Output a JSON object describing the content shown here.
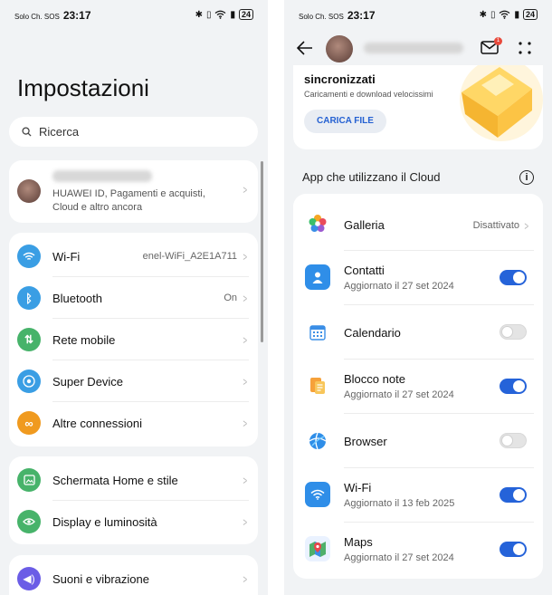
{
  "colors": {
    "accent": "#2563d9",
    "background": "#f1f3f5",
    "card": "#ffffff",
    "wifi": "#3a9ee4",
    "bluetooth": "#3a9ee4",
    "mobile": "#47b36a",
    "super_device": "#3a9ee4",
    "connections": "#f09a1f",
    "home": "#47b36a",
    "display": "#47b36a",
    "sound": "#6b5de6"
  },
  "left": {
    "status": {
      "carrier": "Solo Ch. SOS",
      "time": "23:17",
      "battery": "24"
    },
    "title": "Impostazioni",
    "search": {
      "placeholder": "Ricerca",
      "icon": "search-icon"
    },
    "account": {
      "subtitle": "HUAWEI ID, Pagamenti e acquisti, Cloud e altro ancora"
    },
    "group1": [
      {
        "label": "Wi-Fi",
        "value": "enel-WiFi_A2E1A711",
        "icon": "wifi-icon"
      },
      {
        "label": "Bluetooth",
        "value": "On",
        "icon": "bluetooth-icon"
      },
      {
        "label": "Rete mobile",
        "value": "",
        "icon": "mobile-network-icon"
      },
      {
        "label": "Super Device",
        "value": "",
        "icon": "super-device-icon"
      },
      {
        "label": "Altre connessioni",
        "value": "",
        "icon": "link-icon"
      }
    ],
    "group2": [
      {
        "label": "Schermata Home e stile",
        "icon": "home-screen-icon"
      },
      {
        "label": "Display e luminosità",
        "icon": "display-icon"
      }
    ],
    "group3": [
      {
        "label": "Suoni e vibrazione",
        "icon": "sound-icon"
      }
    ]
  },
  "right": {
    "status": {
      "carrier": "Solo Ch. SOS",
      "time": "23:17",
      "battery": "24"
    },
    "notification_count": "1",
    "promo": {
      "title": "sincronizzati",
      "subtitle": "Caricamenti e download velocissimi",
      "button": "CARICA FILE"
    },
    "section_title": "App che utilizzano il Cloud",
    "apps": [
      {
        "name": "Galleria",
        "sub": "",
        "value": "Disattivato",
        "toggle": null,
        "icon": "gallery-icon"
      },
      {
        "name": "Contatti",
        "sub": "Aggiornato il 27 set 2024",
        "toggle": true,
        "icon": "contacts-icon"
      },
      {
        "name": "Calendario",
        "sub": "",
        "toggle": false,
        "icon": "calendar-icon"
      },
      {
        "name": "Blocco note",
        "sub": "Aggiornato il 27 set 2024",
        "toggle": true,
        "icon": "notepad-icon"
      },
      {
        "name": "Browser",
        "sub": "",
        "toggle": false,
        "icon": "browser-icon"
      },
      {
        "name": "Wi-Fi",
        "sub": "Aggiornato il 13 feb 2025",
        "toggle": true,
        "icon": "wifi-icon"
      },
      {
        "name": "Maps",
        "sub": "Aggiornato il 27 set 2024",
        "toggle": true,
        "icon": "maps-icon"
      }
    ]
  }
}
